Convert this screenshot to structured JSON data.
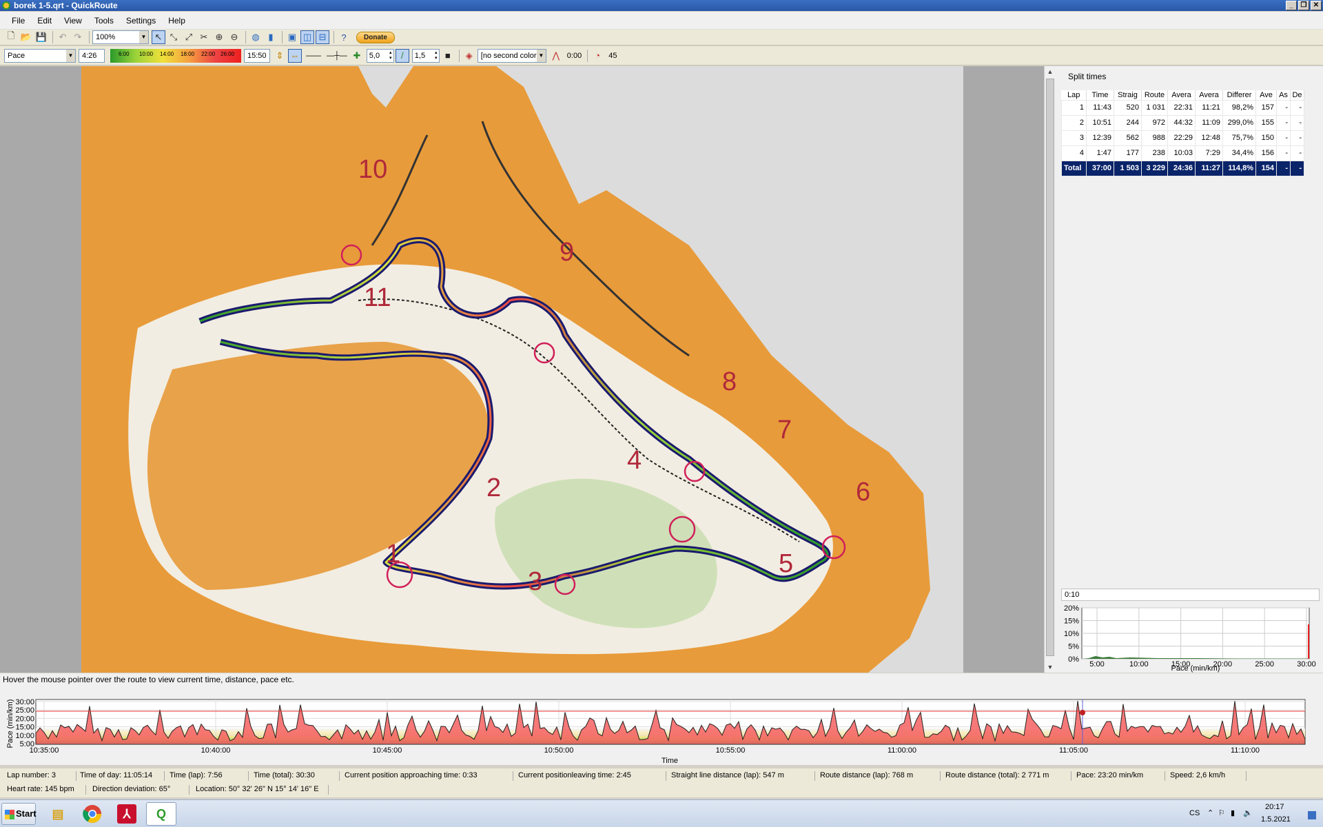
{
  "window": {
    "title": "borek 1-5.qrt - QuickRoute"
  },
  "menu": [
    "File",
    "Edit",
    "View",
    "Tools",
    "Settings",
    "Help"
  ],
  "toolbar1": {
    "zoom": "100%",
    "donate": "Donate"
  },
  "toolbar2": {
    "color_mode": "Pace",
    "range_min": "4:26",
    "gradient_labels": [
      "6:00",
      "10:00",
      "14:00",
      "18:00",
      "22:00",
      "26:00"
    ],
    "range_max": "15:50",
    "line_width": "5,0",
    "mask_width": "1,5",
    "second_color": "[no second color",
    "smoothing": "0:00",
    "threshold": "45"
  },
  "map": {
    "control_numbers": [
      "10",
      "9",
      "11",
      "8",
      "7",
      "6",
      "4",
      "2",
      "1",
      "3",
      "5"
    ]
  },
  "split_times": {
    "title": "Split times",
    "columns": [
      "Lap",
      "Time",
      "Straig",
      "Route",
      "Avera",
      "Avera",
      "Differer",
      "Ave",
      "As",
      "De"
    ],
    "rows": [
      [
        "1",
        "11:43",
        "520",
        "1 031",
        "22:31",
        "11:21",
        "98,2%",
        "157",
        "-",
        "-"
      ],
      [
        "2",
        "10:51",
        "244",
        "972",
        "44:32",
        "11:09",
        "299,0%",
        "155",
        "-",
        "-"
      ],
      [
        "3",
        "12:39",
        "562",
        "988",
        "22:29",
        "12:48",
        "75,7%",
        "150",
        "-",
        "-"
      ],
      [
        "4",
        "1:47",
        "177",
        "238",
        "10:03",
        "7:29",
        "34,4%",
        "156",
        "-",
        "-"
      ]
    ],
    "total": [
      "Total",
      "37:00",
      "1 503",
      "3 229",
      "24:36",
      "11:27",
      "114,8%",
      "154",
      "-",
      "-"
    ]
  },
  "histogram": {
    "interval": "0:10",
    "y_ticks": [
      "20%",
      "15%",
      "10%",
      "5%",
      "0%"
    ],
    "x_ticks": [
      "5:00",
      "10:00",
      "15:00",
      "20:00",
      "25:00",
      "30:00"
    ],
    "xlabel": "Pace (min/km)"
  },
  "hover_text": "Hover the mouse pointer over the route to view current time, distance, pace etc.",
  "line_graph": {
    "ylabel": "Pace (min/km)",
    "y_ticks": [
      "30:00",
      "25:00",
      "20:00",
      "15:00",
      "10:00",
      "5:00"
    ],
    "x_ticks": [
      "10:35:00",
      "10:40:00",
      "10:45:00",
      "10:50:00",
      "10:55:00",
      "11:00:00",
      "11:05:00",
      "11:10:00"
    ],
    "xlabel": "Time"
  },
  "info": {
    "lap_number": "Lap number: 3",
    "time_of_day": "Time of day: 11:05:14",
    "time_lap": "Time (lap): 7:56",
    "time_total": "Time (total): 30:30",
    "approaching": "Current position approaching time: 0:33",
    "leaving": "Current positionleaving time: 2:45",
    "straight": "Straight line distance (lap): 547 m",
    "route_lap": "Route distance (lap): 768 m",
    "route_total": "Route distance (total): 2 771 m",
    "pace": "Pace: 23:20 min/km",
    "speed": "Speed: 2,6 km/h",
    "heart_rate": "Heart rate: 145 bpm",
    "direction": "Direction deviation: 65°",
    "location": "Location: 50° 32' 26\" N   15° 14' 16\" E"
  },
  "taskbar": {
    "start": "Start",
    "lang": "CS",
    "time": "20:17",
    "date": "1.5.2021"
  },
  "colors": {
    "selection": "#0a246a",
    "route_dark": "#1a1a6e",
    "map_orange": "#e89b3a"
  }
}
